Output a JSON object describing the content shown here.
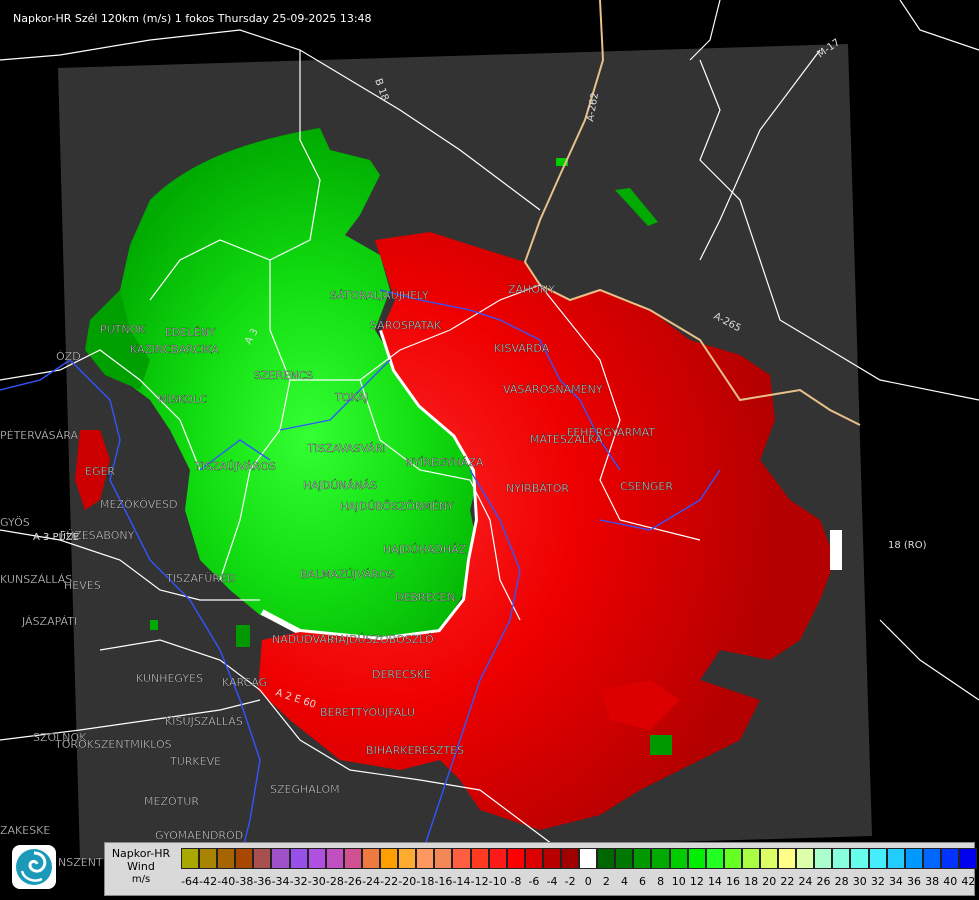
{
  "title": "Napkor-HR Szél 120km (m/s) 1 fokos Thursday 25-09-2025 13:48",
  "place_labels": [
    {
      "text": "SÁTORALJAÚJHELY"
    },
    {
      "text": "SÁROSPATAK"
    },
    {
      "text": "ZÁHONY"
    },
    {
      "text": "KISVÁRDA"
    },
    {
      "text": "VÁSÁROSNAMÉNY"
    },
    {
      "text": "FEHÉRGYARMAT"
    },
    {
      "text": "MÁTÉSZALKA"
    },
    {
      "text": "CSENGER"
    },
    {
      "text": "NYÍRBÁTOR"
    },
    {
      "text": "NYÍREGYHÁZA"
    },
    {
      "text": "TISZAVASVÁRI"
    },
    {
      "text": "HAJDÚNÁNÁS"
    },
    {
      "text": "HAJDÚBÖSZÖRMÉNY"
    },
    {
      "text": "BALMAZÚJVÁROS"
    },
    {
      "text": "DEBRECEN"
    },
    {
      "text": "HAJDÚSZOBOSZLÓ"
    },
    {
      "text": "DERECSKE"
    },
    {
      "text": "BERETTYÓÚJFALU"
    },
    {
      "text": "BIHARKERESZTES"
    },
    {
      "text": "SZEGHALOM"
    },
    {
      "text": "TISZAFÜRED"
    },
    {
      "text": "KUNHEGYES"
    },
    {
      "text": "KARCAG"
    },
    {
      "text": "KISÚJSZÁLLÁS"
    },
    {
      "text": "TÚRKEVE"
    },
    {
      "text": "MEZŐTÚR"
    },
    {
      "text": "GYOMAENDRŐD"
    },
    {
      "text": "SZOLNOK"
    },
    {
      "text": "TÖRÖKSZENTMIKLÓS"
    },
    {
      "text": "EGER"
    },
    {
      "text": "MEZŐKÖVESD"
    },
    {
      "text": "HEVES"
    },
    {
      "text": "JÁSZAPÁTI"
    },
    {
      "text": "ÓZD"
    },
    {
      "text": "PUTNOK"
    },
    {
      "text": "EDELÉNY"
    },
    {
      "text": "KAZINCBARCIKA"
    },
    {
      "text": "SZERENCS"
    },
    {
      "text": "TOKAJ"
    },
    {
      "text": "PÉTERVÁSÁRA"
    },
    {
      "text": "GYÖS"
    },
    {
      "text": "MISKOLC"
    },
    {
      "text": "TISZAÚJVÁROS"
    },
    {
      "text": "NÁDUDVAR"
    },
    {
      "text": "HAJDÚHADHÁZ"
    },
    {
      "text": "FÜZESABONY"
    },
    {
      "text": "KUNSZÁLLÁS"
    },
    {
      "text": "ZAKESKE"
    },
    {
      "text": "NSZENT"
    }
  ],
  "road_labels": [
    {
      "text": "M-17"
    },
    {
      "text": "A-262"
    },
    {
      "text": "A-265"
    },
    {
      "text": "B 18"
    },
    {
      "text": "A 3"
    },
    {
      "text": "18 (RO)"
    },
    {
      "text": "A 2 E 60"
    },
    {
      "text": "A 3 PÜZE"
    }
  ],
  "legend": {
    "line1": "Napkor-HR",
    "line2": "Wind",
    "unit": "m/s",
    "ticks": [
      "-64",
      "-42",
      "-40",
      "-38",
      "-36",
      "-34",
      "-32",
      "-30",
      "-28",
      "-26",
      "-24",
      "-22",
      "-20",
      "-18",
      "-16",
      "-14",
      "-12",
      "-10",
      "-8",
      "-6",
      "-4",
      "-2",
      "0",
      "2",
      "4",
      "6",
      "8",
      "10",
      "12",
      "14",
      "16",
      "18",
      "20",
      "22",
      "24",
      "26",
      "28",
      "30",
      "32",
      "34",
      "36",
      "38",
      "40",
      "42"
    ],
    "colors": [
      "#a8a800",
      "#a88400",
      "#a86400",
      "#a84800",
      "#a85050",
      "#a050c8",
      "#9850e8",
      "#b050e0",
      "#c050c0",
      "#d05090",
      "#ee7a40",
      "#ffa000",
      "#ffaa30",
      "#ff9860",
      "#f28858",
      "#ff5e40",
      "#ff3a20",
      "#ff1a1a",
      "#ff0000",
      "#dd0000",
      "#b80000",
      "#a00000",
      "#ffffff",
      "#006600",
      "#007700",
      "#009900",
      "#00aa00",
      "#00cc00",
      "#00ee00",
      "#22ff22",
      "#66ff22",
      "#aaff44",
      "#ddff66",
      "#ffff88",
      "#ddffaa",
      "#aaffcc",
      "#88ffdd",
      "#66ffee",
      "#44eeff",
      "#22ccff",
      "#0099ff",
      "#0066ff",
      "#0033ff",
      "#0000ee"
    ]
  },
  "colors": {
    "background": "#000000",
    "radar_area": "#333333",
    "approaching": "#ff0000",
    "receding": "#00cc00",
    "rivers": "#3355ff",
    "borders": "#ffffff",
    "country_border": "#e8c08a"
  }
}
